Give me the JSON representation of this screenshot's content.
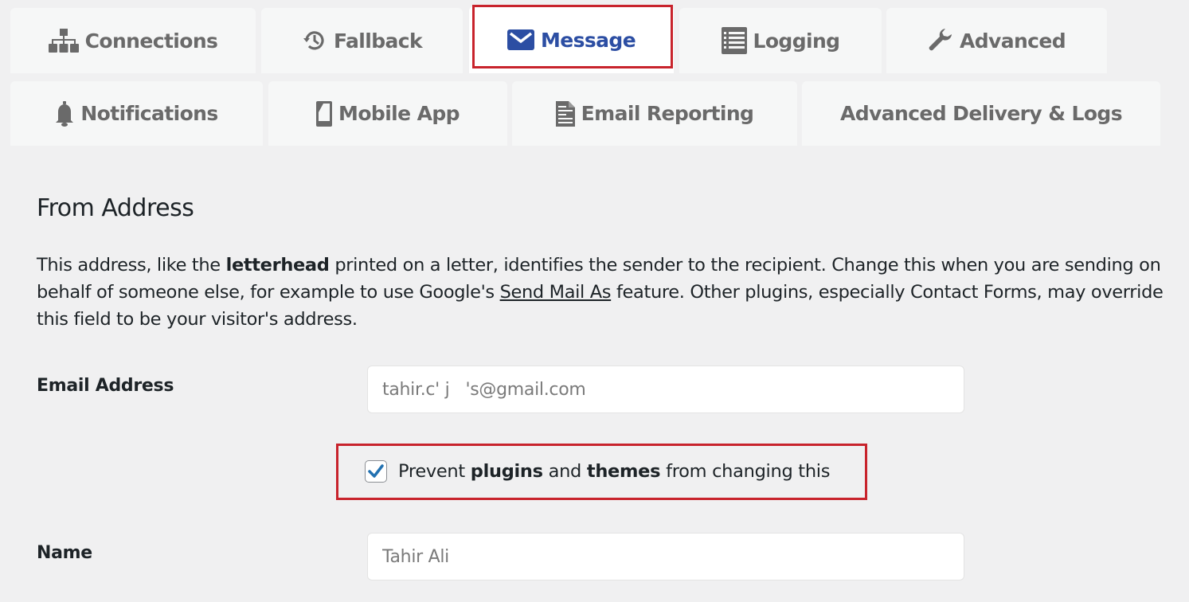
{
  "tabs": {
    "row1": [
      {
        "label": "Connections",
        "icon": "sitemap-icon",
        "active": false
      },
      {
        "label": "Fallback",
        "icon": "history-icon",
        "active": false
      },
      {
        "label": "Message",
        "icon": "envelope-icon",
        "active": true
      },
      {
        "label": "Logging",
        "icon": "list-icon",
        "active": false
      },
      {
        "label": "Advanced",
        "icon": "wrench-icon",
        "active": false
      }
    ],
    "row2": [
      {
        "label": "Notifications",
        "icon": "bell-icon",
        "active": false
      },
      {
        "label": "Mobile App",
        "icon": "mobile-icon",
        "active": false
      },
      {
        "label": "Email Reporting",
        "icon": "document-icon",
        "active": false
      },
      {
        "label": "Advanced Delivery & Logs",
        "icon": null,
        "active": false
      }
    ]
  },
  "colors": {
    "active_tab_text": "#2c4ea3",
    "inactive_tab_text": "#6a6a6a",
    "highlight_border": "#c8232c",
    "checkbox_check": "#2271b1",
    "page_background": "#f0f0f1"
  },
  "section": {
    "heading": "From Address",
    "description": {
      "part1": "This address, like the ",
      "bold1": "letterhead",
      "part2": " printed on a letter, identifies the sender to the recipient. Change this when you are sending on behalf of someone else, for example to use Google's ",
      "link": "Send Mail As",
      "part3": " feature. Other plugins, especially Contact Forms, may override this field to be your visitor's address."
    }
  },
  "fields": {
    "email": {
      "label": "Email Address",
      "value": "tahir.c' j   's@gmail.com"
    },
    "prevent_override": {
      "checked": true,
      "text_prefix": "Prevent ",
      "bold1": "plugins",
      "text_mid": " and ",
      "bold2": "themes",
      "text_suffix": " from changing this"
    },
    "name": {
      "label": "Name",
      "value": "Tahir Ali"
    }
  }
}
